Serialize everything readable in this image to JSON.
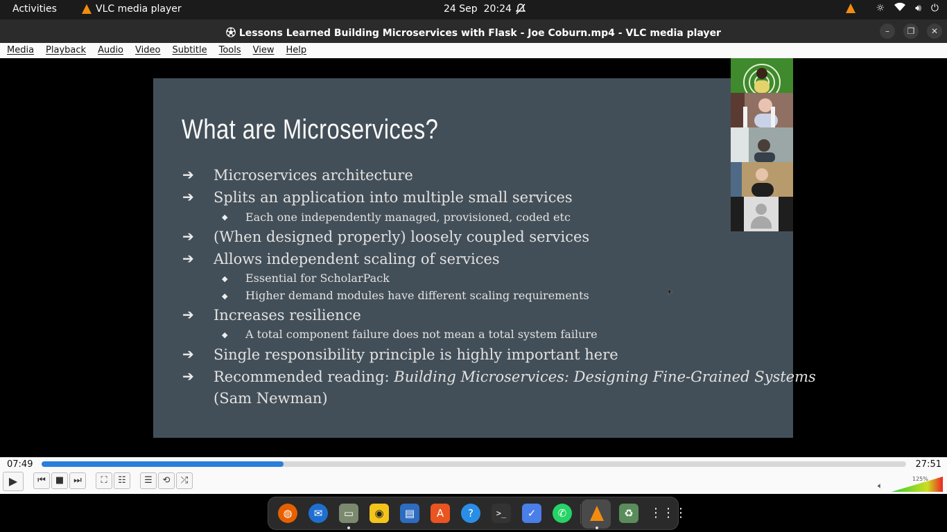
{
  "topbar": {
    "activities": "Activities",
    "app_name": "VLC media player",
    "date": "24 Sep",
    "time": "20:24"
  },
  "window": {
    "title": "Lessons Learned Building Microservices with Flask - Joe Coburn.mp4 - VLC media player"
  },
  "menu": [
    "Media",
    "Playback",
    "Audio",
    "Video",
    "Subtitle",
    "Tools",
    "View",
    "Help"
  ],
  "slide": {
    "title": "What are Microservices?",
    "bullets": [
      "Microservices architecture",
      "Splits an application into multiple small services",
      "Each one independently managed, provisioned, coded etc",
      "(When designed properly) loosely coupled services",
      "Allows independent scaling of services",
      "Essential for ScholarPack",
      "Higher demand modules have different scaling requirements",
      "Increases resilience",
      "A total component failure does not mean a total system failure",
      "Single responsibility principle is highly important here",
      "Recommended reading: ",
      "Building Microservices: Designing Fine-Grained Systems",
      "(Sam Newman)"
    ]
  },
  "playback": {
    "elapsed": "07:49",
    "total": "27:51",
    "progress": 0.28,
    "volume_label": "125%",
    "volume": 1.25
  }
}
